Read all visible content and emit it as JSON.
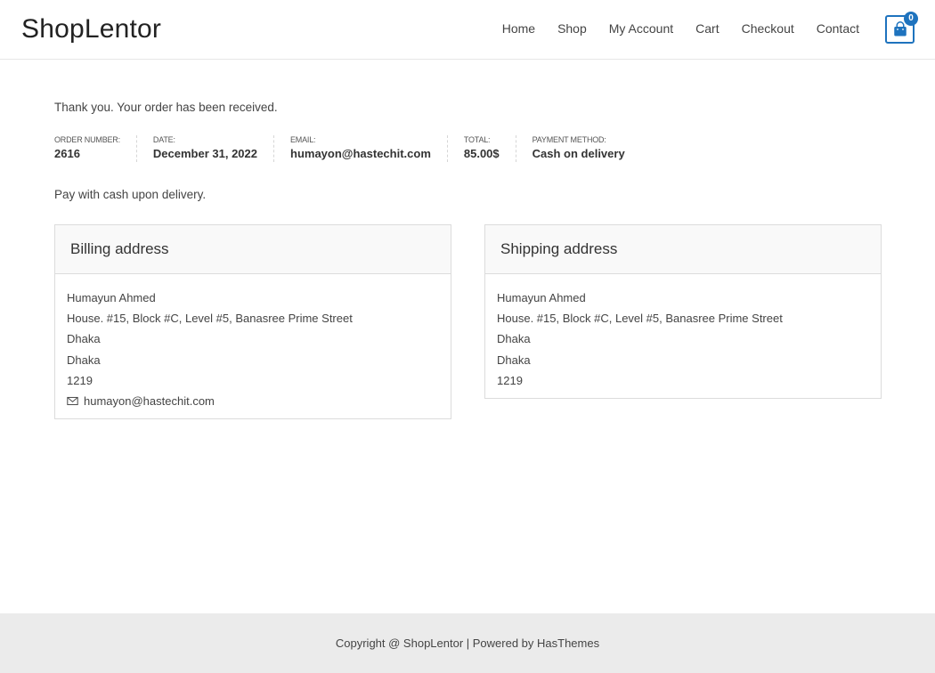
{
  "header": {
    "logo": "ShopLentor",
    "nav": [
      "Home",
      "Shop",
      "My Account",
      "Cart",
      "Checkout",
      "Contact"
    ],
    "cart_count": "0",
    "cart_icon": "shopping-bag-icon"
  },
  "order": {
    "thank_you": "Thank you. Your order has been received.",
    "overview": [
      {
        "label": "ORDER NUMBER:",
        "value": "2616"
      },
      {
        "label": "DATE:",
        "value": "December 31, 2022"
      },
      {
        "label": "EMAIL:",
        "value": "humayon@hastechit.com"
      },
      {
        "label": "TOTAL:",
        "value": "85.00$"
      },
      {
        "label": "PAYMENT METHOD:",
        "value": "Cash on delivery"
      }
    ],
    "payment_note": "Pay with cash upon delivery."
  },
  "billing": {
    "title": "Billing address",
    "lines": [
      "Humayun Ahmed",
      "House. #15, Block #C, Level #5, Banasree Prime Street",
      "Dhaka",
      "Dhaka",
      "1219"
    ],
    "email": "humayon@hastechit.com",
    "email_icon": "envelope-icon"
  },
  "shipping": {
    "title": "Shipping address",
    "lines": [
      "Humayun Ahmed",
      "House. #15, Block #C, Level #5, Banasree Prime Street",
      "Dhaka",
      "Dhaka",
      "1219"
    ]
  },
  "footer": {
    "text": "Copyright @ ShopLentor | Powered by HasThemes"
  },
  "colors": {
    "accent": "#1e73be",
    "footer_bg": "#ebebeb",
    "box_head_bg": "#f9f9f9"
  }
}
